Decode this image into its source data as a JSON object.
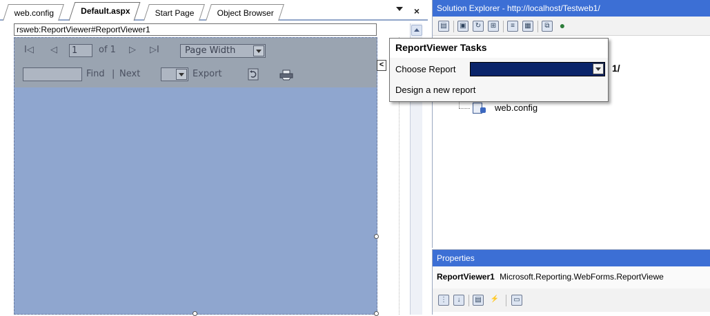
{
  "tabs": [
    {
      "label": "web.config"
    },
    {
      "label": "Default.aspx"
    },
    {
      "label": "Start Page"
    },
    {
      "label": "Object Browser"
    }
  ],
  "tab_close_glyph": "×",
  "markup": {
    "text": "rsweb:ReportViewer#ReportViewer1"
  },
  "reportviewer": {
    "first_page_glyph": "I◁",
    "prev_page_glyph": "◁",
    "page_value": "1",
    "of_text": "of 1",
    "next_page_glyph": "▷",
    "last_page_glyph": "▷I",
    "zoom_value": "Page Width",
    "find_label": "Find",
    "separator": "|",
    "next_label": "Next",
    "export_label": "Export"
  },
  "smart_tag_glyph": "<",
  "tasks": {
    "title": "ReportViewer Tasks",
    "choose_report_label": "Choose Report",
    "design_link": "Design a new report"
  },
  "solution_explorer": {
    "title": "Solution Explorer - http://localhost/Testweb1/",
    "project_fragment": "1/",
    "file": "web.config"
  },
  "properties": {
    "title": "Properties",
    "object_name": "ReportViewer1",
    "object_type": "Microsoft.Reporting.WebForms.ReportViewe"
  },
  "colors": {
    "panel_title": "#3c6fd5",
    "report_body": "#8fa6cf",
    "report_toolbar": "#9aa4b1",
    "selected_dropdown": "#0a246a"
  }
}
